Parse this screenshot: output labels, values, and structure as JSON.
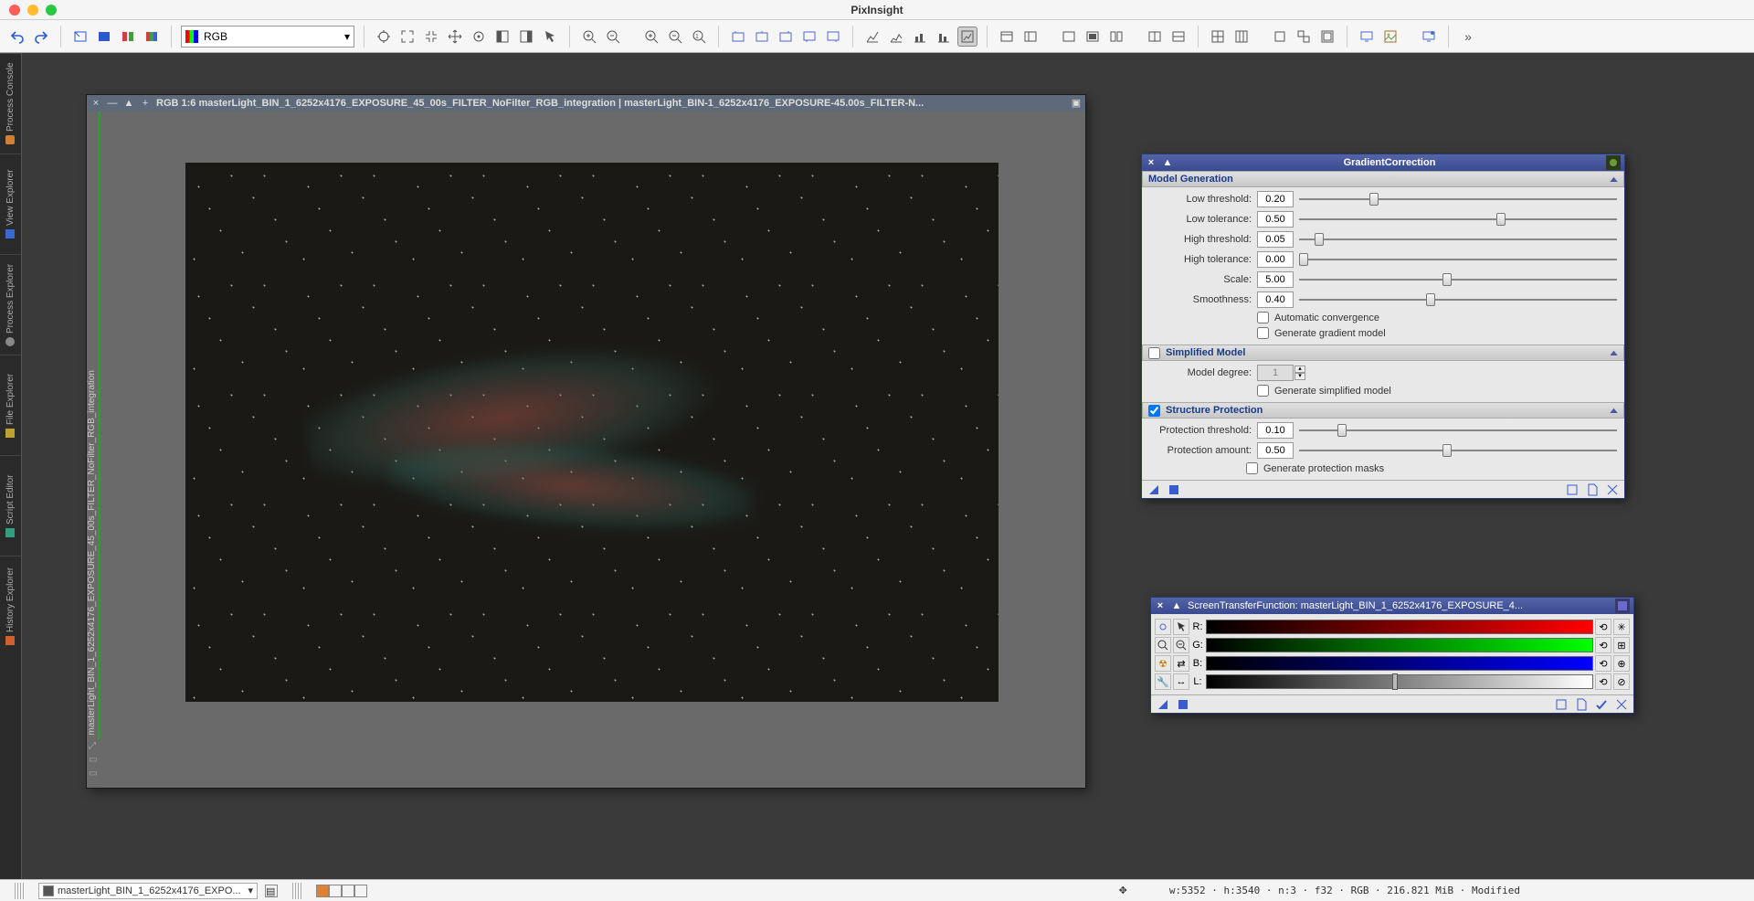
{
  "app": {
    "title": "PixInsight"
  },
  "toolbar": {
    "channel_label": "RGB"
  },
  "side_tabs": [
    "Process Console",
    "View Explorer",
    "Process Explorer",
    "File Explorer",
    "Script Editor",
    "History Explorer"
  ],
  "image_window": {
    "title": "RGB 1:6 masterLight_BIN_1_6252x4176_EXPOSURE_45_00s_FILTER_NoFilter_RGB_integration | masterLight_BIN-1_6252x4176_EXPOSURE-45.00s_FILTER-N...",
    "vlabel": "masterLight_BIN_1_6252x4176_EXPOSURE_45_00s_FILTER_NoFilter_RGB_integration"
  },
  "gradient_correction": {
    "title": "GradientCorrection",
    "sections": {
      "model_gen": {
        "label": "Model Generation",
        "low_threshold": {
          "label": "Low threshold:",
          "value": "0.20",
          "pos": 0.22
        },
        "low_tolerance": {
          "label": "Low tolerance:",
          "value": "0.50",
          "pos": 0.62
        },
        "high_threshold": {
          "label": "High threshold:",
          "value": "0.05",
          "pos": 0.05
        },
        "high_tolerance": {
          "label": "High tolerance:",
          "value": "0.00",
          "pos": 0.0
        },
        "scale": {
          "label": "Scale:",
          "value": "5.00",
          "pos": 0.45
        },
        "smoothness": {
          "label": "Smoothness:",
          "value": "0.40",
          "pos": 0.4
        },
        "auto_conv": "Automatic convergence",
        "gen_grad": "Generate gradient model"
      },
      "simplified": {
        "label": "Simplified Model",
        "checked": false,
        "model_degree": {
          "label": "Model degree:",
          "value": "1"
        },
        "gen_simple": "Generate simplified model"
      },
      "structure": {
        "label": "Structure Protection",
        "checked": true,
        "prot_threshold": {
          "label": "Protection threshold:",
          "value": "0.10",
          "pos": 0.12
        },
        "prot_amount": {
          "label": "Protection amount:",
          "value": "0.50",
          "pos": 0.45
        },
        "gen_masks": "Generate protection masks"
      }
    }
  },
  "stf": {
    "title": "ScreenTransferFunction: masterLight_BIN_1_6252x4176_EXPOSURE_4...",
    "rows": {
      "r": "R:",
      "g": "G:",
      "b": "B:",
      "l": "L:"
    }
  },
  "statusbar": {
    "image_selector": "masterLight_BIN_1_6252x4176_EXPO...",
    "info": "w:5352 · h:3540 · n:3 · f32 · RGB · 216.821 MiB · Modified"
  }
}
